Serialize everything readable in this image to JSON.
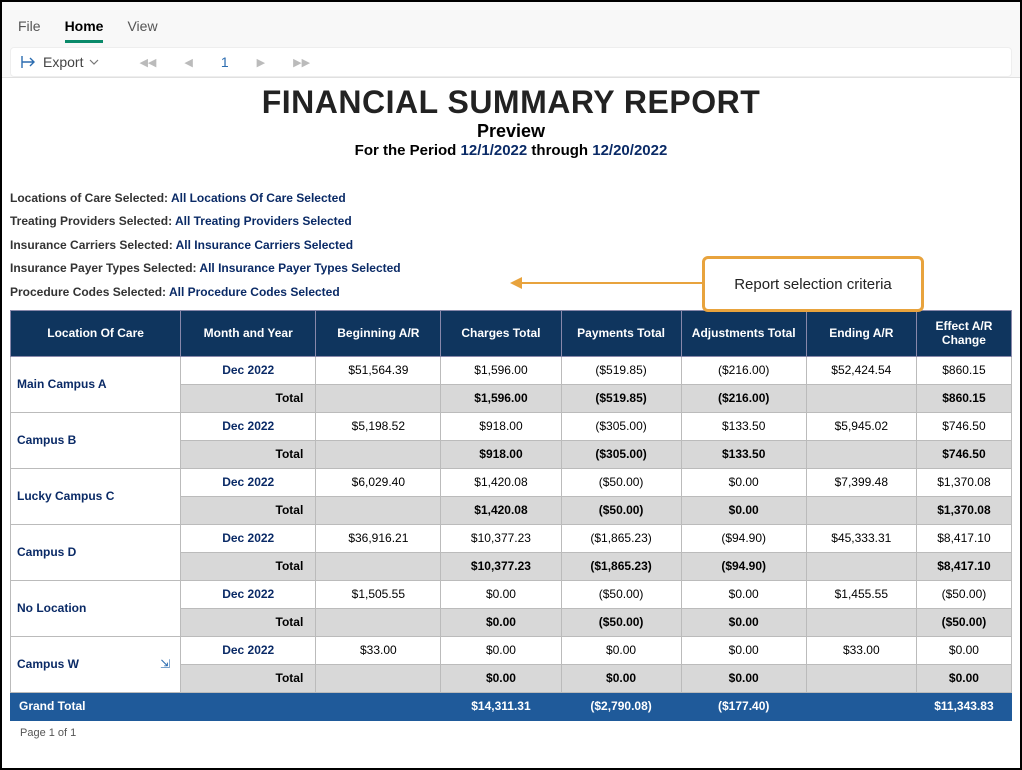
{
  "menu": {
    "file": "File",
    "home": "Home",
    "view": "View"
  },
  "toolbar": {
    "export": "Export",
    "page": "1"
  },
  "report": {
    "title": "FINANCIAL SUMMARY REPORT",
    "subtitle": "Preview",
    "period_prefix": "For the Period ",
    "period_start": "12/1/2022",
    "period_mid": " through ",
    "period_end": "12/20/2022"
  },
  "criteria": [
    {
      "label": "Locations of Care Selected: ",
      "value": "All Locations Of Care Selected"
    },
    {
      "label": "Treating Providers Selected: ",
      "value": "All Treating Providers Selected"
    },
    {
      "label": "Insurance Carriers Selected: ",
      "value": "All Insurance Carriers Selected"
    },
    {
      "label": "Insurance Payer Types Selected: ",
      "value": "All Insurance Payer Types Selected"
    },
    {
      "label": "Procedure Codes Selected: ",
      "value": "All Procedure Codes Selected"
    }
  ],
  "headers": [
    "Location Of Care",
    "Month and Year",
    "Beginning A/R",
    "Charges Total",
    "Payments Total",
    "Adjustments Total",
    "Ending A/R",
    "Effect A/R Change"
  ],
  "rows": [
    {
      "loc": "Main Campus A",
      "data": {
        "month": "Dec 2022",
        "beg": "$51,564.39",
        "chg": "$1,596.00",
        "pay": "($519.85)",
        "adj": "($216.00)",
        "end": "$52,424.54",
        "eff": "$860.15"
      },
      "total": {
        "chg": "$1,596.00",
        "pay": "($519.85)",
        "adj": "($216.00)",
        "eff": "$860.15"
      }
    },
    {
      "loc": "Campus B",
      "data": {
        "month": "Dec 2022",
        "beg": "$5,198.52",
        "chg": "$918.00",
        "pay": "($305.00)",
        "adj": "$133.50",
        "end": "$5,945.02",
        "eff": "$746.50"
      },
      "total": {
        "chg": "$918.00",
        "pay": "($305.00)",
        "adj": "$133.50",
        "eff": "$746.50"
      }
    },
    {
      "loc": "Lucky Campus C",
      "data": {
        "month": "Dec 2022",
        "beg": "$6,029.40",
        "chg": "$1,420.08",
        "pay": "($50.00)",
        "adj": "$0.00",
        "end": "$7,399.48",
        "eff": "$1,370.08"
      },
      "total": {
        "chg": "$1,420.08",
        "pay": "($50.00)",
        "adj": "$0.00",
        "eff": "$1,370.08"
      }
    },
    {
      "loc": "Campus D",
      "data": {
        "month": "Dec 2022",
        "beg": "$36,916.21",
        "chg": "$10,377.23",
        "pay": "($1,865.23)",
        "adj": "($94.90)",
        "end": "$45,333.31",
        "eff": "$8,417.10"
      },
      "total": {
        "chg": "$10,377.23",
        "pay": "($1,865.23)",
        "adj": "($94.90)",
        "eff": "$8,417.10"
      }
    },
    {
      "loc": "No Location",
      "data": {
        "month": "Dec 2022",
        "beg": "$1,505.55",
        "chg": "$0.00",
        "pay": "($50.00)",
        "adj": "$0.00",
        "end": "$1,455.55",
        "eff": "($50.00)"
      },
      "total": {
        "chg": "$0.00",
        "pay": "($50.00)",
        "adj": "$0.00",
        "eff": "($50.00)"
      }
    },
    {
      "loc": "Campus W",
      "data": {
        "month": "Dec 2022",
        "beg": "$33.00",
        "chg": "$0.00",
        "pay": "$0.00",
        "adj": "$0.00",
        "end": "$33.00",
        "eff": "$0.00"
      },
      "total": {
        "chg": "$0.00",
        "pay": "$0.00",
        "adj": "$0.00",
        "eff": "$0.00"
      }
    }
  ],
  "total_label": "Total",
  "grand": {
    "label": "Grand Total",
    "chg": "$14,311.31",
    "pay": "($2,790.08)",
    "adj": "($177.40)",
    "eff": "$11,343.83"
  },
  "footer": "Page 1 of 1",
  "callout": "Report selection criteria"
}
